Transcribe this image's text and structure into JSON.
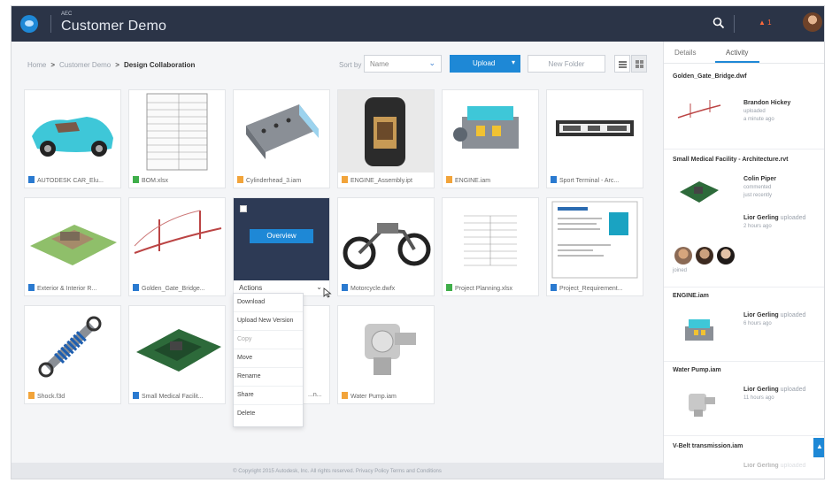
{
  "header": {
    "brand": "AEC",
    "title": "Customer Demo",
    "notification_count": "1",
    "icons": [
      "logo-icon",
      "search-icon",
      "bell-icon",
      "user-avatar"
    ]
  },
  "breadcrumb": [
    "Home",
    "Customer Demo",
    "Design Collaboration"
  ],
  "toolbar": {
    "sort_label": "Sort by",
    "sort_value": "Name",
    "upload_label": "Upload",
    "new_folder_label": "New Folder"
  },
  "files": [
    {
      "name": "AUTODESK CAR_Elu...",
      "icon": "blue"
    },
    {
      "name": "BOM.xlsx",
      "icon": "green"
    },
    {
      "name": "Cylinderhead_3.iam",
      "icon": "orange"
    },
    {
      "name": "ENGINE_Assembly.ipt",
      "icon": "orange"
    },
    {
      "name": "ENGINE.iam",
      "icon": "orange"
    },
    {
      "name": "Sport Terminal - Arc...",
      "icon": "blue"
    },
    {
      "name": "Exterior & Interior R...",
      "icon": "blue"
    },
    {
      "name": "Golden_Gate_Bridge...",
      "icon": "blue"
    },
    {
      "name": "Actions",
      "icon": "none"
    },
    {
      "name": "Motorcycle.dwfx",
      "icon": "blue"
    },
    {
      "name": "Project Planning.xlsx",
      "icon": "green"
    },
    {
      "name": "Project_Requirement...",
      "icon": "blue"
    },
    {
      "name": "Shock.f3d",
      "icon": "orange"
    },
    {
      "name": "Small Medical Facilit...",
      "icon": "blue"
    },
    {
      "name": "...n...",
      "icon": "blue"
    },
    {
      "name": "Water Pump.iam",
      "icon": "orange"
    }
  ],
  "hover_tile": {
    "overview_label": "Overview",
    "actions_label": "Actions"
  },
  "actions_menu": [
    "Download",
    "Upload New Version",
    "Copy",
    "Move",
    "Rename",
    "Share",
    "Delete"
  ],
  "footer": "© Copyright 2015 Autodesk, Inc. All rights reserved.   Privacy Policy   Terms and Conditions",
  "sidebar": {
    "tabs": [
      "Details",
      "Activity"
    ],
    "activity": [
      {
        "title": "Golden_Gate_Bridge.dwf",
        "user": "Brandon Hickey",
        "verb": "uploaded",
        "time": "a minute ago"
      },
      {
        "title": "Small Medical Facility - Architecture.rvt",
        "user": "Colin Piper",
        "verb": "commented",
        "time": "just recently",
        "user2": "Lior Gerling",
        "verb2": "uploaded",
        "time2": "2 hours ago"
      },
      {
        "title": "ENGINE.iam",
        "user": "Lior Gerling",
        "verb": "uploaded",
        "time": "6 hours ago"
      },
      {
        "title": "Water Pump.iam",
        "user": "Lior Gerling",
        "verb": "uploaded",
        "time": "11 hours ago"
      },
      {
        "title": "V-Belt transmission.iam",
        "user": "Lior Gerling",
        "verb": "uploaded",
        "time": ""
      }
    ],
    "joined_label": "joined"
  },
  "accent_color": "#1e88d6"
}
